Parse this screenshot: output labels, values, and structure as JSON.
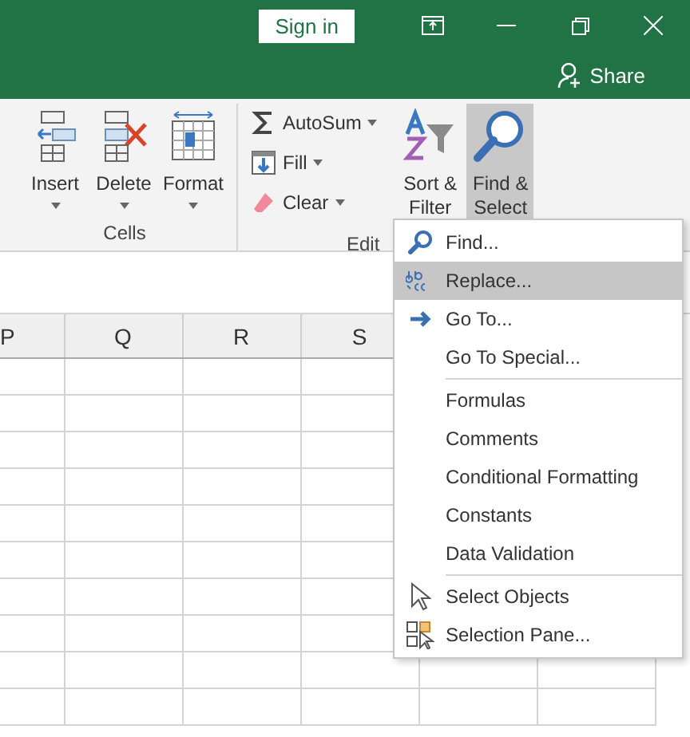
{
  "title_bar": {
    "sign_in": "Sign in",
    "share": "Share"
  },
  "ribbon": {
    "groups": [
      {
        "label": "Cells",
        "kind": "cells",
        "buttons": [
          {
            "label": "Insert"
          },
          {
            "label": "Delete"
          },
          {
            "label": "Format"
          }
        ]
      },
      {
        "label": "Edit",
        "kind": "editing",
        "small_buttons": [
          {
            "label": "AutoSum"
          },
          {
            "label": "Fill"
          },
          {
            "label": "Clear"
          }
        ],
        "buttons": [
          {
            "label": "Sort & Filter",
            "selected": false
          },
          {
            "label": "Find & Select",
            "selected": true
          }
        ]
      }
    ]
  },
  "sheet": {
    "columns": [
      "P",
      "Q",
      "R",
      "S"
    ]
  },
  "menu": {
    "sections": [
      [
        {
          "label": "Find...",
          "selected": false
        },
        {
          "label": "Replace...",
          "selected": true
        },
        {
          "label": "Go To...",
          "selected": false
        },
        {
          "label": "Go To Special...",
          "selected": false
        }
      ],
      [
        {
          "label": "Formulas",
          "selected": false
        },
        {
          "label": "Comments",
          "selected": false
        },
        {
          "label": "Conditional Formatting",
          "selected": false
        },
        {
          "label": "Constants",
          "selected": false
        },
        {
          "label": "Data Validation",
          "selected": false
        }
      ],
      [
        {
          "label": "Select Objects",
          "selected": false
        },
        {
          "label": "Selection Pane...",
          "selected": false
        }
      ]
    ]
  }
}
